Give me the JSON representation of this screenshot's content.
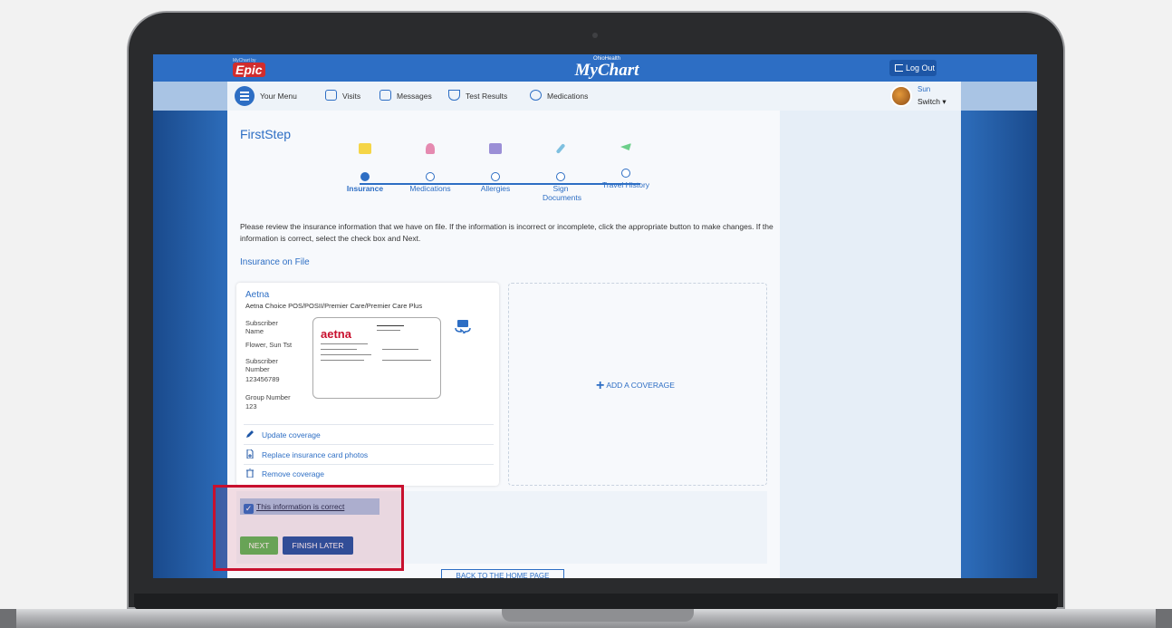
{
  "header": {
    "epic_small": "MyChart by",
    "epic_logo": "Epic",
    "brand_small": "OhioHealth",
    "brand_title": "MyChart",
    "logout_label": "Log Out"
  },
  "nav": {
    "menu_label": "Your Menu",
    "items": [
      {
        "label": "Visits",
        "icon": "calendar-icon"
      },
      {
        "label": "Messages",
        "icon": "envelope-icon"
      },
      {
        "label": "Test Results",
        "icon": "flask-icon"
      },
      {
        "label": "Medications",
        "icon": "pills-icon"
      }
    ],
    "user_name": "Sun",
    "switch_label": "Switch ▾"
  },
  "page": {
    "title": "FirstStep",
    "instructions": "Please review the insurance information that we have on file. If the information is incorrect or incomplete, click the appropriate button to make changes. If the information is correct, select the check box and Next.",
    "section_title": "Insurance on File"
  },
  "steps": [
    {
      "label": "Insurance",
      "active": true,
      "color": "#f5d547"
    },
    {
      "label": "Medications",
      "active": false,
      "color": "#e58ab0"
    },
    {
      "label": "Allergies",
      "active": false,
      "color": "#9b8fd6"
    },
    {
      "label": "Sign Documents",
      "active": false,
      "color": "#7ec0e0"
    },
    {
      "label": "Travel History",
      "active": false,
      "color": "#6ccf8a"
    }
  ],
  "coverage": {
    "payer": "Aetna",
    "plan": "Aetna Choice POS/POSII/Premier Care/Premier Care Plus",
    "subscriber_name_label": "Subscriber Name",
    "subscriber_name": "Flower, Sun Tst",
    "subscriber_number_label": "Subscriber Number",
    "subscriber_number": "123456789",
    "group_number_label": "Group Number",
    "group_number": "123",
    "card_logo": "aetna",
    "actions": {
      "update": "Update coverage",
      "replace": "Replace insurance card photos",
      "remove": "Remove coverage"
    }
  },
  "add_coverage_label": "ADD A COVERAGE",
  "confirm": {
    "checkbox_label": "This information is correct",
    "checked": true
  },
  "buttons": {
    "next": "NEXT",
    "finish_later": "FINISH LATER",
    "home": "BACK TO THE HOME PAGE"
  },
  "colors": {
    "accent": "#2d6ec4",
    "next_green": "#5cb85c",
    "highlight_red": "#c8102e"
  }
}
